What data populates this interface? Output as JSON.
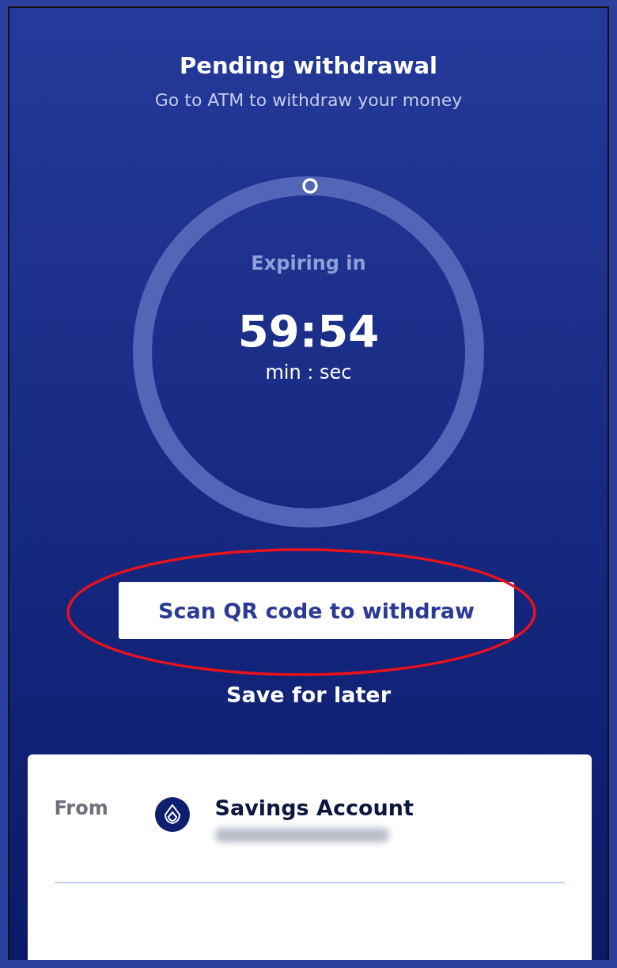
{
  "header": {
    "title": "Pending withdrawal",
    "subtitle": "Go to ATM to withdraw your money"
  },
  "timer": {
    "label": "Expiring in",
    "value": "59:54",
    "unit": "min : sec"
  },
  "actions": {
    "primary": "Scan QR code to withdraw",
    "secondary": "Save for later"
  },
  "account": {
    "from_label": "From",
    "name": "Savings Account"
  }
}
